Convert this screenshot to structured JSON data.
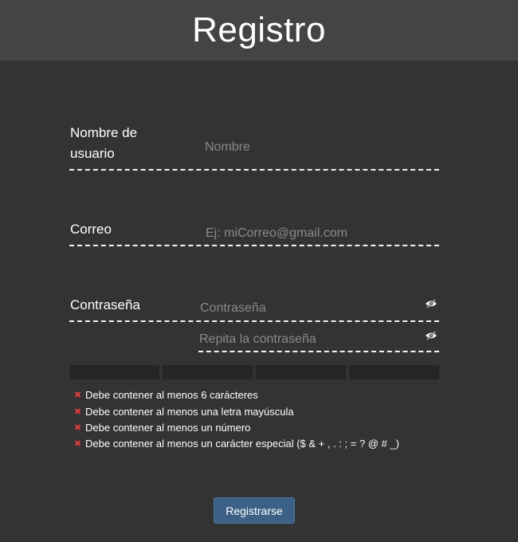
{
  "page": {
    "title": "Registro"
  },
  "form": {
    "username": {
      "label": "Nombre de usuario",
      "placeholder": "Nombre",
      "value": ""
    },
    "email": {
      "label": "Correo",
      "placeholder": "Ej: miCorreo@gmail.com",
      "value": ""
    },
    "password": {
      "label": "Contraseña",
      "placeholder": "Contraseña",
      "confirm_placeholder": "Repita la contraseña",
      "toggle_icon": "eye-slash-icon"
    },
    "strength_meter": {
      "segments": 4,
      "filled": 0
    },
    "requirements": [
      {
        "text": "Debe contener al menos 6 carácteres",
        "status": "unmet"
      },
      {
        "text": "Debe contener al menos una letra mayúscula",
        "status": "unmet"
      },
      {
        "text": "Debe contener al menos un número",
        "status": "unmet"
      },
      {
        "text": "Debe contener al menos un carácter especial ($ & + , . : ; = ? @ # _)",
        "status": "unmet"
      }
    ],
    "requirement_mark": "✖",
    "submit_label": "Registrarse"
  },
  "colors": {
    "background": "#333333",
    "header": "#444444",
    "button": "#3d6186",
    "error_mark": "#e23b3b"
  }
}
